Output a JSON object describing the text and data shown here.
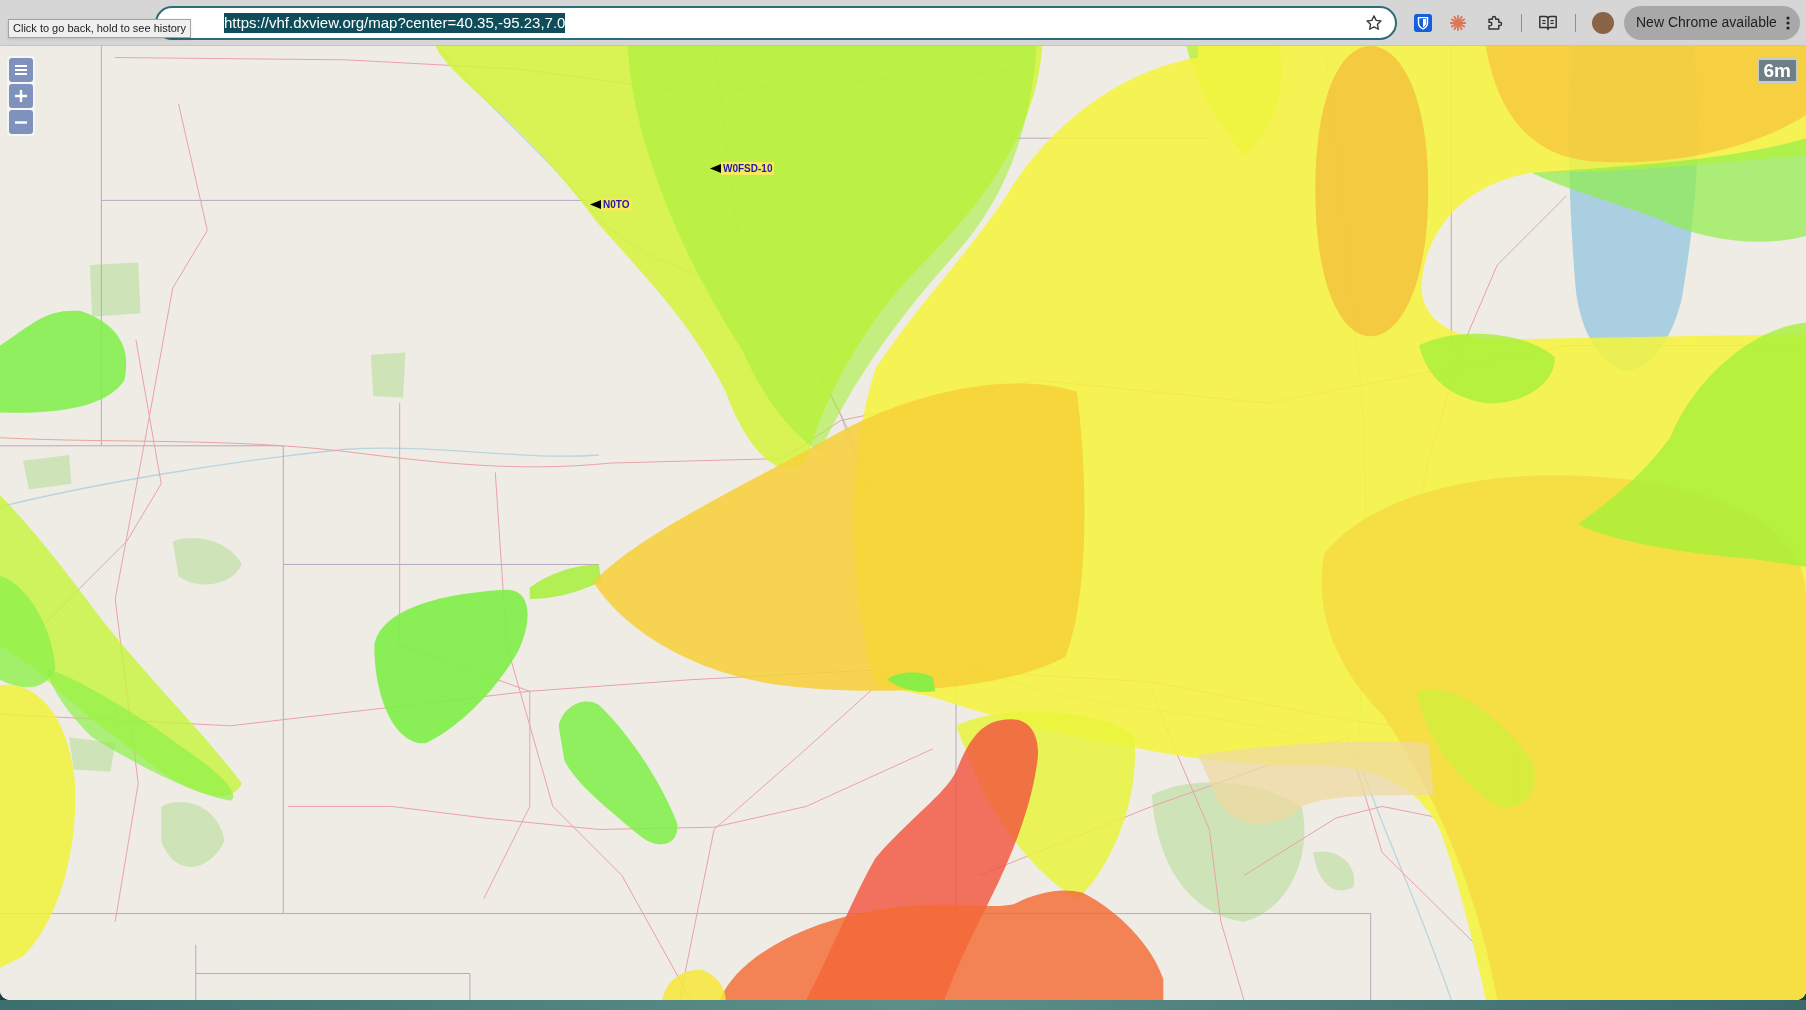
{
  "browser": {
    "tooltip": "Click to go back, hold to see history",
    "address": "https://vhf.dxview.org/map?center=40.35,-95.23,7.0",
    "address_selected": true,
    "update_button": "New Chrome available"
  },
  "map": {
    "band_badge": "6m",
    "stations": [
      {
        "callsign": "W0FSD-10"
      },
      {
        "callsign": "N0TO"
      }
    ]
  }
}
